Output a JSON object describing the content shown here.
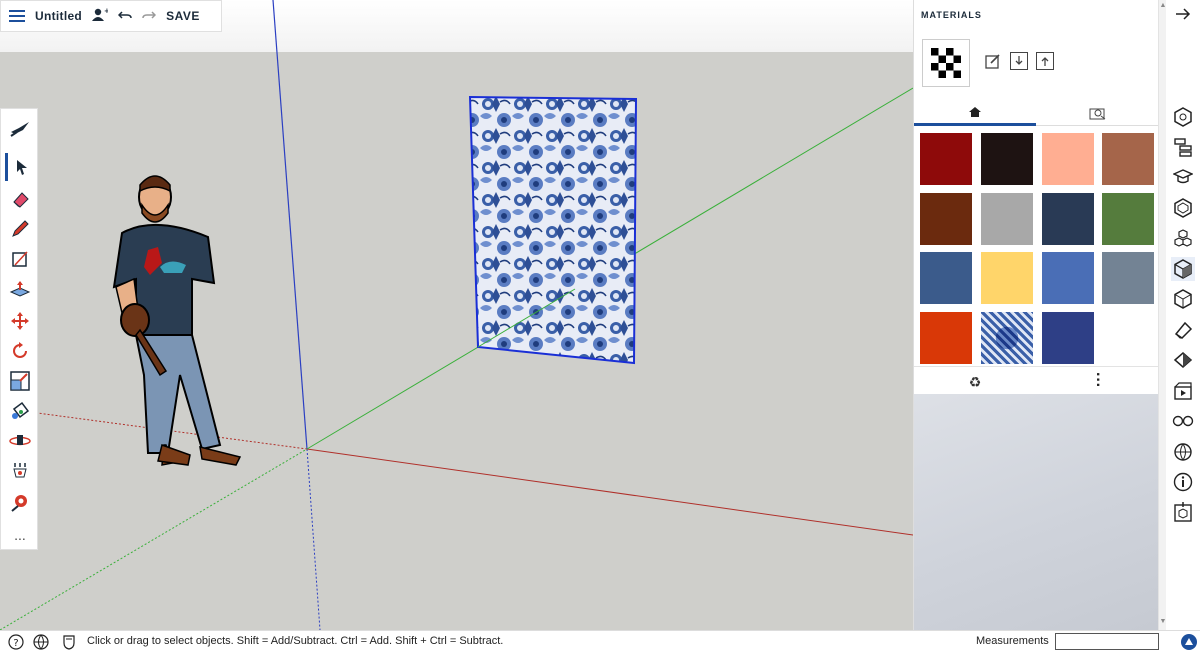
{
  "header": {
    "title": "Untitled",
    "save_label": "SAVE",
    "menu_icon": "hamburger-menu-icon",
    "user_icon": "user-icon",
    "undo_icon": "undo-icon",
    "redo_icon": "redo-icon"
  },
  "toolbar": {
    "tools": [
      "select-tool",
      "eraser-tool",
      "pencil-tool",
      "rectangle-tool",
      "push-pull-tool",
      "move-tool",
      "rotate-tool",
      "scale-tool",
      "paint-bucket-tool",
      "orbit-tool",
      "walk-tool",
      "position-camera-tool"
    ],
    "more_label": "..."
  },
  "materials_panel": {
    "title": "MATERIALS",
    "actions": [
      "edit-material-icon",
      "import-icon",
      "export-icon"
    ],
    "tabs": [
      "home-icon",
      "in-model-icon"
    ],
    "swatches": [
      [
        "#8e0a0a",
        "#1e1312",
        "#ffae92",
        "#a5654a"
      ],
      [
        "#6b2a0e",
        "#a8a8a8",
        "#293a55",
        "#557c3d"
      ],
      [
        "#3b5b8b",
        "#ffd56a",
        "#4a6eb6",
        "#738394"
      ],
      [
        "#d93807",
        "tile-texture",
        "#2e3f86"
      ]
    ],
    "recycle_icon": "recycle-icon",
    "more_icon": "more-options-icon"
  },
  "right_rail": {
    "icons": [
      "entity-info-icon",
      "outliner-icon",
      "instructor-icon",
      "components-icon",
      "3d-warehouse-icon",
      "materials-icon",
      "solid-tools-icon",
      "styles-icon",
      "tags-icon",
      "scenes-icon",
      "display-icon",
      "shadows-icon",
      "model-info-icon",
      "section-icon"
    ],
    "expand_icon": "arrow-right-icon"
  },
  "status": {
    "message": "Click or drag to select objects. Shift = Add/Subtract. Ctrl = Add. Shift + Ctrl = Subtract.",
    "measurements_label": "Measurements",
    "measurements_value": ""
  },
  "colors": {
    "accent": "#1c4f9c",
    "ground": "#cfcfcb",
    "red_axis": "#c0392b",
    "green_axis": "#3ab03a",
    "blue_axis": "#2b3fc2"
  }
}
